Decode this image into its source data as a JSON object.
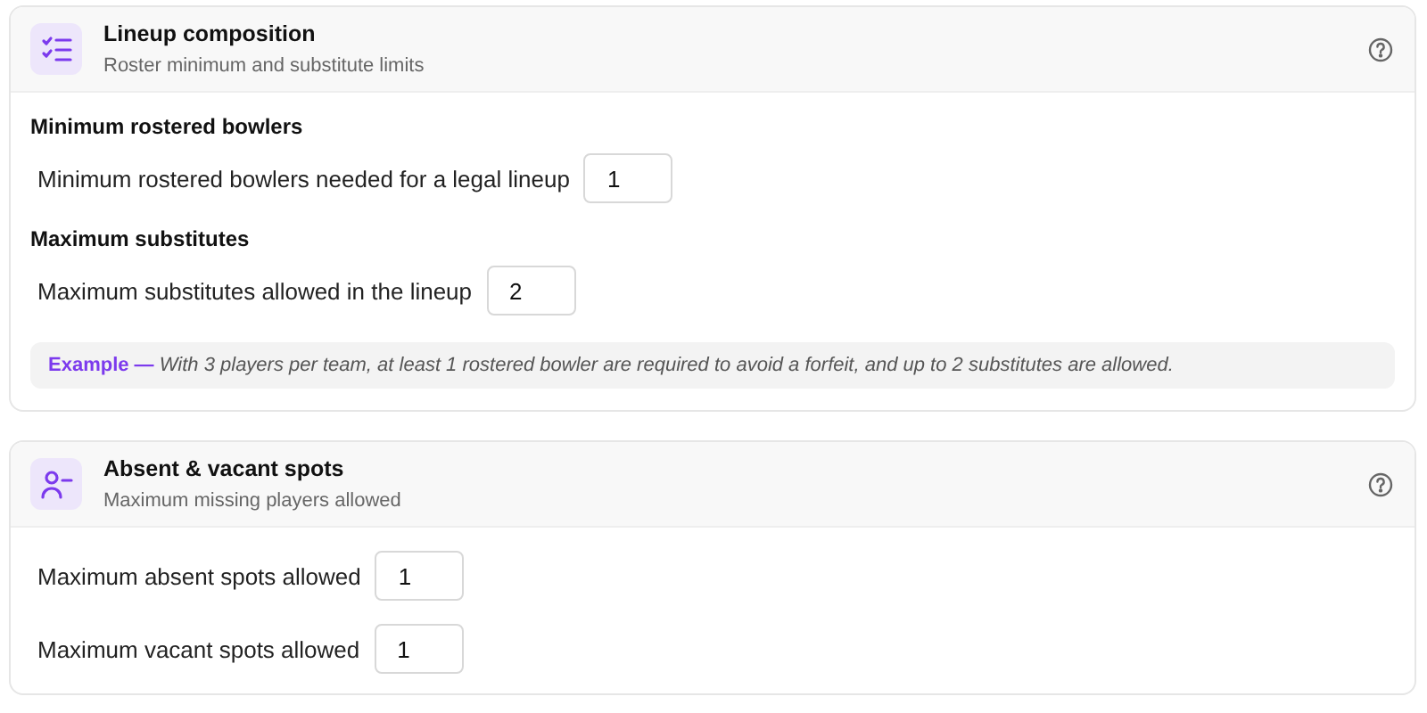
{
  "cards": [
    {
      "title": "Lineup composition",
      "subtitle": "Roster minimum and substitute limits",
      "blocks": [
        {
          "kind": "group",
          "heading": "Minimum rostered bowlers",
          "fields": [
            {
              "label": "Minimum rostered bowlers needed for a legal lineup",
              "value": "1"
            }
          ]
        },
        {
          "kind": "group",
          "heading": "Maximum substitutes",
          "fields": [
            {
              "label": "Maximum substitutes allowed in the lineup",
              "value": "2"
            }
          ]
        },
        {
          "kind": "note",
          "lead": "Example —",
          "text": "With 3 players per team, at least 1 rostered bowler are required to avoid a forfeit, and up to 2 substitutes are allowed."
        }
      ]
    },
    {
      "title": "Absent & vacant spots",
      "subtitle": "Maximum missing players allowed",
      "blocks": [
        {
          "kind": "field",
          "label": "Maximum absent spots allowed",
          "value": "1"
        },
        {
          "kind": "field",
          "label": "Maximum vacant spots allowed",
          "value": "1"
        }
      ]
    }
  ]
}
